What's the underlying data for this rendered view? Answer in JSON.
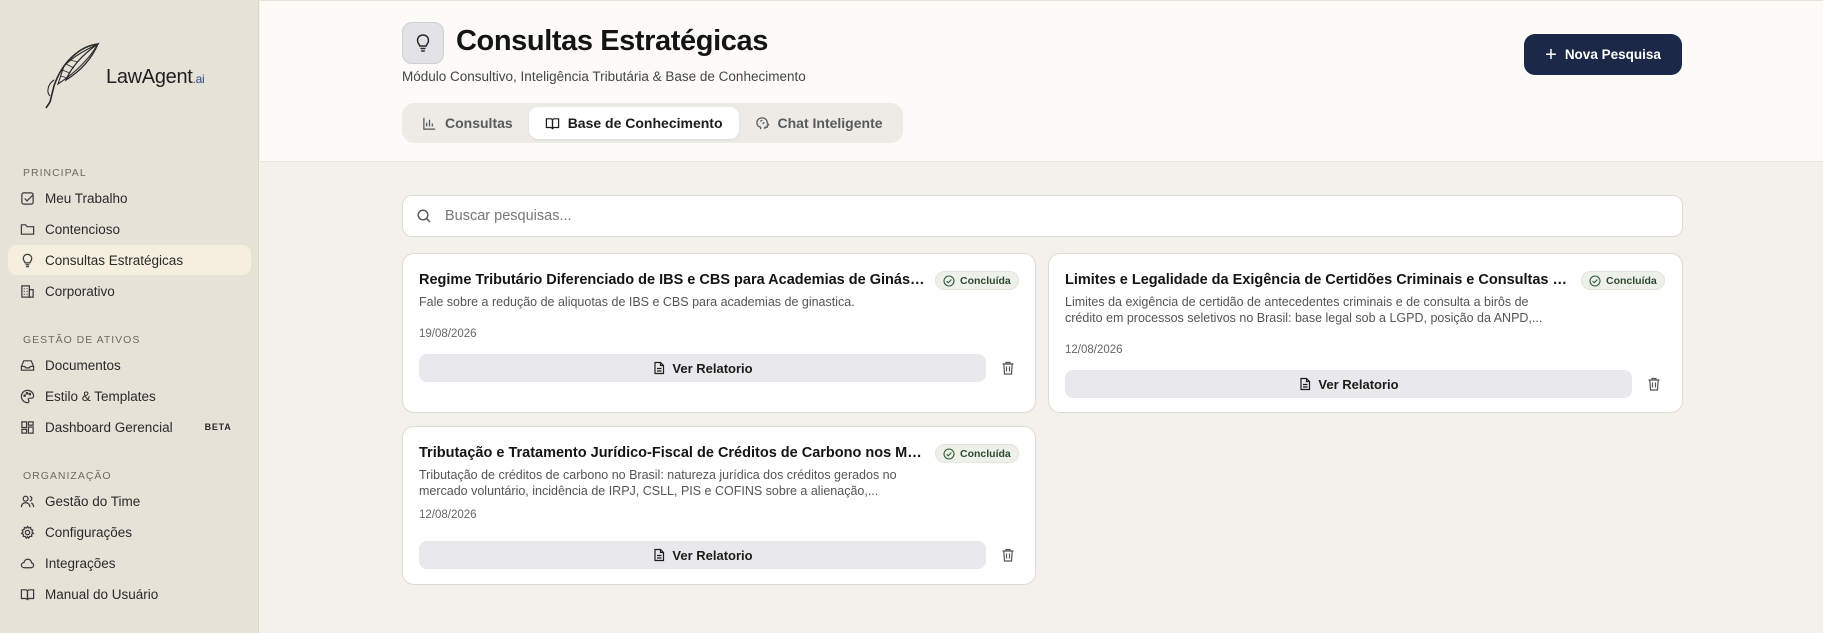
{
  "brand": {
    "name": "LawAgent",
    "suffix": ".ai"
  },
  "sidebar": {
    "sections": [
      {
        "heading": "PRINCIPAL",
        "items": [
          {
            "label": "Meu Trabalho",
            "icon": "checkbox-icon"
          },
          {
            "label": "Contencioso",
            "icon": "folder-icon"
          },
          {
            "label": "Consultas Estratégicas",
            "icon": "lightbulb-icon",
            "active": true
          },
          {
            "label": "Corporativo",
            "icon": "building-icon"
          }
        ]
      },
      {
        "heading": "GESTÃO DE ATIVOS",
        "items": [
          {
            "label": "Documentos",
            "icon": "inbox-icon"
          },
          {
            "label": "Estilo & Templates",
            "icon": "palette-icon"
          },
          {
            "label": "Dashboard Gerencial",
            "icon": "dashboard-icon",
            "badge": "BETA"
          }
        ]
      },
      {
        "heading": "ORGANIZAÇÃO",
        "items": [
          {
            "label": "Gestão do Time",
            "icon": "users-icon"
          },
          {
            "label": "Configurações",
            "icon": "gear-icon"
          },
          {
            "label": "Integrações",
            "icon": "cloud-icon"
          },
          {
            "label": "Manual do Usuário",
            "icon": "book-icon"
          }
        ]
      }
    ]
  },
  "header": {
    "title": "Consultas Estratégicas",
    "subtitle": "Módulo Consultivo, Inteligência Tributária & Base de Conhecimento",
    "new_button": "Nova Pesquisa",
    "tabs": [
      {
        "label": "Consultas",
        "icon": "bar-chart-icon"
      },
      {
        "label": "Base de Conhecimento",
        "icon": "open-book-icon",
        "active": true
      },
      {
        "label": "Chat Inteligente",
        "icon": "brain-icon"
      }
    ]
  },
  "search": {
    "placeholder": "Buscar pesquisas..."
  },
  "cards": [
    {
      "title": "Regime Tributário Diferenciado de IBS e CBS para Academias de Ginástica",
      "status": "Concluída",
      "description": "Fale sobre a redução de aliquotas de IBS e CBS para academias de ginastica.",
      "date": "19/08/2026",
      "action": "Ver Relatorio"
    },
    {
      "title": "Limites e Legalidade da Exigência de Certidões Criminais e Consultas a Birôs de Crédito",
      "status": "Concluída",
      "description": "Limites da exigência de certidão de antecedentes criminais e de consulta a birôs de crédito em processos seletivos no Brasil: base legal sob a LGPD, posição da ANPD,...",
      "date": "12/08/2026",
      "action": "Ver Relatorio"
    },
    {
      "title": "Tributação e Tratamento Jurídico-Fiscal de Créditos de Carbono nos Mercados",
      "status": "Concluída",
      "description": "Tributação de créditos de carbono no Brasil: natureza jurídica dos créditos gerados no mercado voluntário, incidência de IRPJ, CSLL, PIS e COFINS sobre a alienação,...",
      "date": "12/08/2026",
      "action": "Ver Relatorio"
    }
  ]
}
